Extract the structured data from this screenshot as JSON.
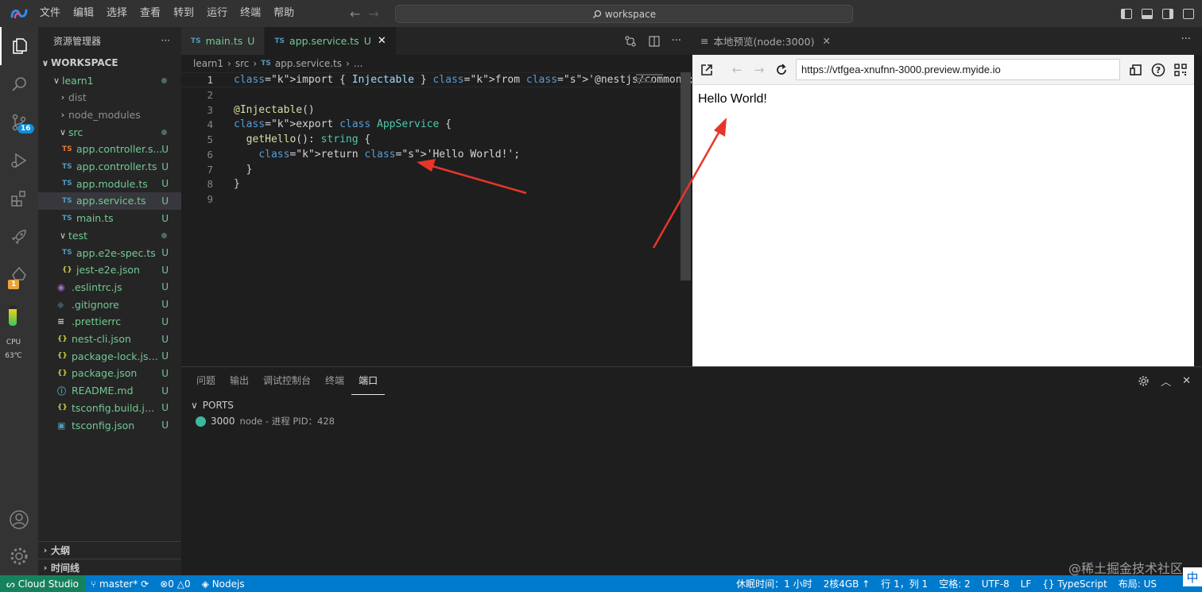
{
  "titlebar": {
    "menus": [
      "文件",
      "编辑",
      "选择",
      "查看",
      "转到",
      "运行",
      "终端",
      "帮助"
    ],
    "command_center": "workspace",
    "back_icon": "arrow-left-icon",
    "forward_icon": "arrow-right-icon"
  },
  "activitybar": {
    "items": [
      "explorer-icon",
      "search-icon",
      "source-control-icon",
      "run-debug-icon",
      "extensions-icon",
      "rocket-icon",
      "cloud-icon"
    ],
    "source_control_badge": "16",
    "cloud_badge": "1",
    "cpu_label": "CPU",
    "cpu_temp": "63℃",
    "account_icon": "account-icon",
    "settings_icon": "gear-icon"
  },
  "sidebar": {
    "title": "资源管理器",
    "more": "···",
    "workspace": "WORKSPACE",
    "tree": [
      {
        "label": "learn1",
        "kind": "folder-open",
        "depth": 1,
        "status": "dot"
      },
      {
        "label": "dist",
        "kind": "folder",
        "depth": 2,
        "status": ""
      },
      {
        "label": "node_modules",
        "kind": "folder",
        "depth": 2,
        "status": ""
      },
      {
        "label": "src",
        "kind": "folder-open",
        "depth": 2,
        "status": "dot"
      },
      {
        "label": "app.controller.s...",
        "kind": "ts-orange",
        "depth": 3,
        "status": "U"
      },
      {
        "label": "app.controller.ts",
        "kind": "ts",
        "depth": 3,
        "status": "U"
      },
      {
        "label": "app.module.ts",
        "kind": "ts",
        "depth": 3,
        "status": "U"
      },
      {
        "label": "app.service.ts",
        "kind": "ts",
        "depth": 3,
        "status": "U",
        "selected": true
      },
      {
        "label": "main.ts",
        "kind": "ts",
        "depth": 3,
        "status": "U"
      },
      {
        "label": "test",
        "kind": "folder-open",
        "depth": 2,
        "status": "dot"
      },
      {
        "label": "app.e2e-spec.ts",
        "kind": "ts",
        "depth": 3,
        "status": "U"
      },
      {
        "label": "jest-e2e.json",
        "kind": "json",
        "depth": 3,
        "status": "U"
      },
      {
        "label": ".eslintrc.js",
        "kind": "eslint",
        "depth": 2,
        "status": "U"
      },
      {
        "label": ".gitignore",
        "kind": "git",
        "depth": 2,
        "status": "U"
      },
      {
        "label": ".prettierrc",
        "kind": "lines",
        "depth": 2,
        "status": "U"
      },
      {
        "label": "nest-cli.json",
        "kind": "json",
        "depth": 2,
        "status": "U"
      },
      {
        "label": "package-lock.json",
        "kind": "json",
        "depth": 2,
        "status": "U"
      },
      {
        "label": "package.json",
        "kind": "json",
        "depth": 2,
        "status": "U"
      },
      {
        "label": "README.md",
        "kind": "info",
        "depth": 2,
        "status": "U"
      },
      {
        "label": "tsconfig.build.json",
        "kind": "json",
        "depth": 2,
        "status": "U"
      },
      {
        "label": "tsconfig.json",
        "kind": "tsconfig",
        "depth": 2,
        "status": "U"
      }
    ],
    "outline": "大纲",
    "timeline": "时间线"
  },
  "editor": {
    "tabs": [
      {
        "label": "main.ts",
        "status": "U",
        "active": false
      },
      {
        "label": "app.service.ts",
        "status": "U",
        "active": true
      }
    ],
    "tab_file_icon": "TS",
    "breadcrumb": [
      "learn1",
      "src",
      "app.service.ts",
      "..."
    ],
    "code_lines": [
      "import { Injectable } from '@nestjs/common';",
      "",
      "@Injectable()",
      "export class AppService {",
      "  getHello(): string {",
      "    return 'Hello World!';",
      "  }",
      "}",
      ""
    ]
  },
  "preview": {
    "tab_label": "本地预览(node:3000)",
    "url": "https://vtfgea-xnufnn-3000.preview.myide.io",
    "content": "Hello World!"
  },
  "panel": {
    "tabs": [
      "问题",
      "输出",
      "调试控制台",
      "终端",
      "端口"
    ],
    "active_tab": "端口",
    "ports_header": "PORTS",
    "port": "3000",
    "port_desc": "node - 进程 PID：428"
  },
  "statusbar": {
    "remote": "Cloud Studio",
    "branch": "master*",
    "errors": "0",
    "warnings": "0",
    "runtime": "Nodejs",
    "right_items": [
      "休眠时间：1 小时",
      "2核4GB",
      "行 1，列 1",
      "空格: 2",
      "UTF-8",
      "LF",
      "TypeScript",
      "布局: US"
    ],
    "ime": "中"
  },
  "watermark": "@稀土掘金技术社区",
  "colors": {
    "statusbar": "#007acc",
    "remote": "#16825d",
    "untracked": "#73c991",
    "arrow": "#e8352a"
  }
}
